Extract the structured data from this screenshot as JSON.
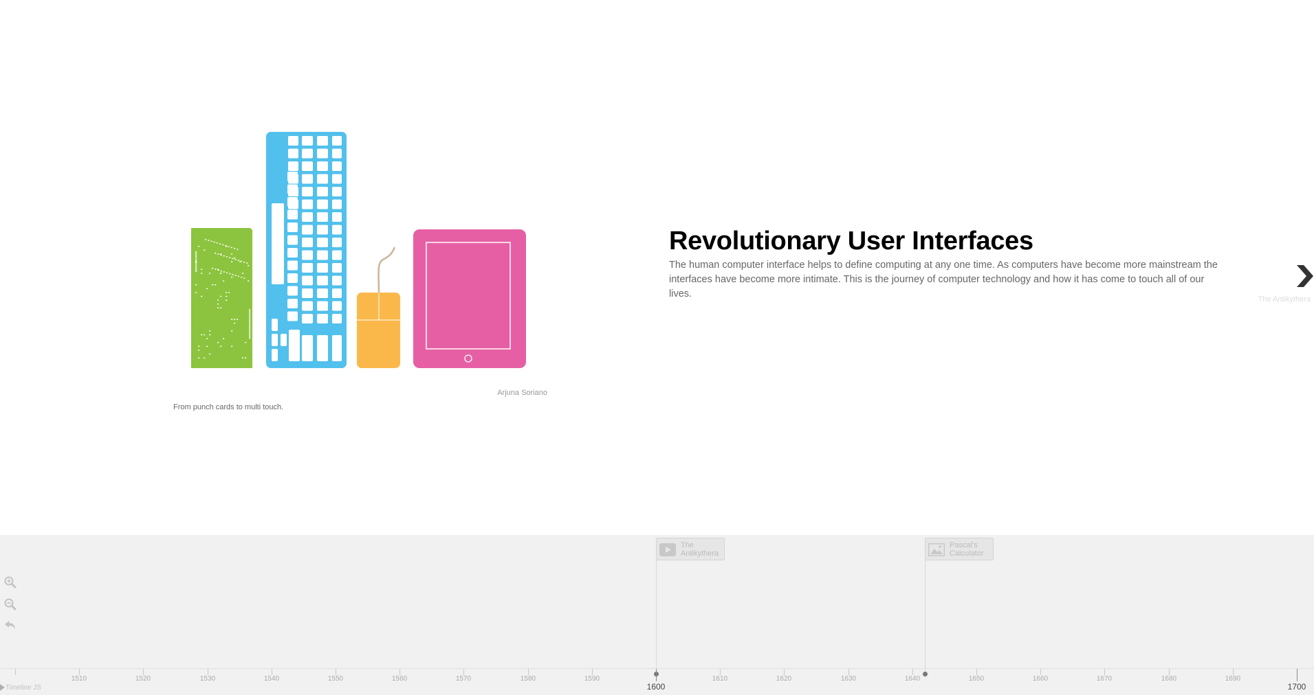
{
  "slide": {
    "headline": "Revolutionary User Interfaces",
    "body": "The human computer interface helps to define computing at any one time. As computers have become more mainstream the interfaces have become more intimate. This is the journey of computer technology and how it has come to touch all of our lives.",
    "media_credit": "Arjuna Soriano",
    "media_caption": "From punch cards to multi touch.",
    "media_icons": [
      "punch-card-icon",
      "keyboard-icon",
      "mouse-icon",
      "tablet-icon"
    ],
    "next": {
      "title": "The Antikythera",
      "icon": "chevron-right-icon"
    }
  },
  "timenav": {
    "tools": [
      "zoom-in-icon",
      "zoom-out-icon",
      "back-to-start-icon"
    ],
    "markers": [
      {
        "title": "The Antikythera",
        "year": 1600,
        "icon": "video-icon"
      },
      {
        "title": "Pascal's Calculator",
        "year": 1642,
        "icon": "image-icon"
      }
    ],
    "axis": {
      "start": 1500,
      "end": 1700,
      "minor_labels": [
        "1510",
        "1520",
        "1530",
        "1540",
        "1550",
        "1560",
        "1570",
        "1580",
        "1590",
        "1610",
        "1620",
        "1630",
        "1640",
        "1650",
        "1660",
        "1670",
        "1680",
        "1690"
      ],
      "major_labels": [
        "1600",
        "1700"
      ]
    },
    "brand": "Timeline JS"
  },
  "colors": {
    "punch_card": "#8cc43f",
    "keyboard": "#52c0ec",
    "mouse": "#fbb84a",
    "tablet": "#e65fa4",
    "timenav_bg": "#f1f1f1"
  }
}
